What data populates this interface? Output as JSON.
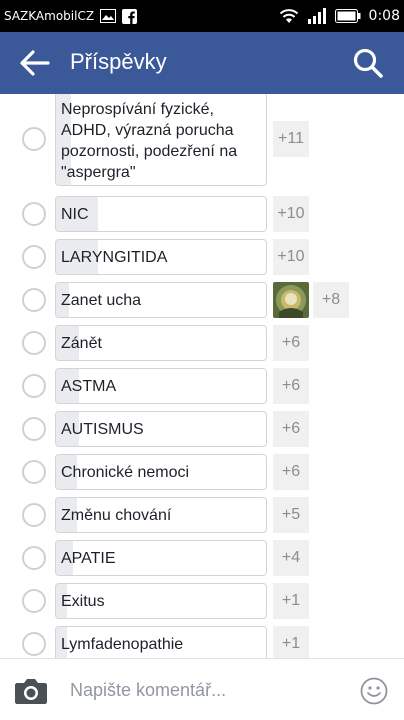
{
  "status_bar": {
    "carrier": "SAZKAmobilCZ",
    "time": "0:08",
    "icons": [
      "image-icon",
      "facebook-icon",
      "wifi-icon",
      "signal-icon",
      "battery-icon"
    ]
  },
  "app_bar": {
    "title": "Příspěvky",
    "back_icon": "arrow-left-icon",
    "search_icon": "search-icon",
    "color": "#3b5998"
  },
  "poll_options": [
    {
      "label": "Neprospívání fyzické, ADHD, výrazná porucha pozornosti, podezření na \"aspergra\"",
      "count": "+11",
      "share": 0.07
    },
    {
      "label": "NIC",
      "count": "+10",
      "share": 0.2
    },
    {
      "label": "LARYNGITIDA",
      "count": "+10",
      "share": 0.2
    },
    {
      "label": "Zanet ucha",
      "count": "+8",
      "share": 0.06,
      "has_thumbnail": true
    },
    {
      "label": "Zánět",
      "count": "+6",
      "share": 0.11
    },
    {
      "label": "ASTMA",
      "count": "+6",
      "share": 0.11
    },
    {
      "label": "AUTISMUS",
      "count": "+6",
      "share": 0.11
    },
    {
      "label": "Chronické nemoci",
      "count": "+6",
      "share": 0.1
    },
    {
      "label": "Změnu chování",
      "count": "+5",
      "share": 0.1
    },
    {
      "label": "APATIE",
      "count": "+4",
      "share": 0.08
    },
    {
      "label": "Exitus",
      "count": "+1",
      "share": 0.05
    },
    {
      "label": "Lymfadenopathie",
      "count": "+1",
      "share": 0.05
    }
  ],
  "composer": {
    "placeholder": "Napište komentář...",
    "camera_icon": "camera-icon",
    "emoji_icon": "smiley-icon"
  }
}
